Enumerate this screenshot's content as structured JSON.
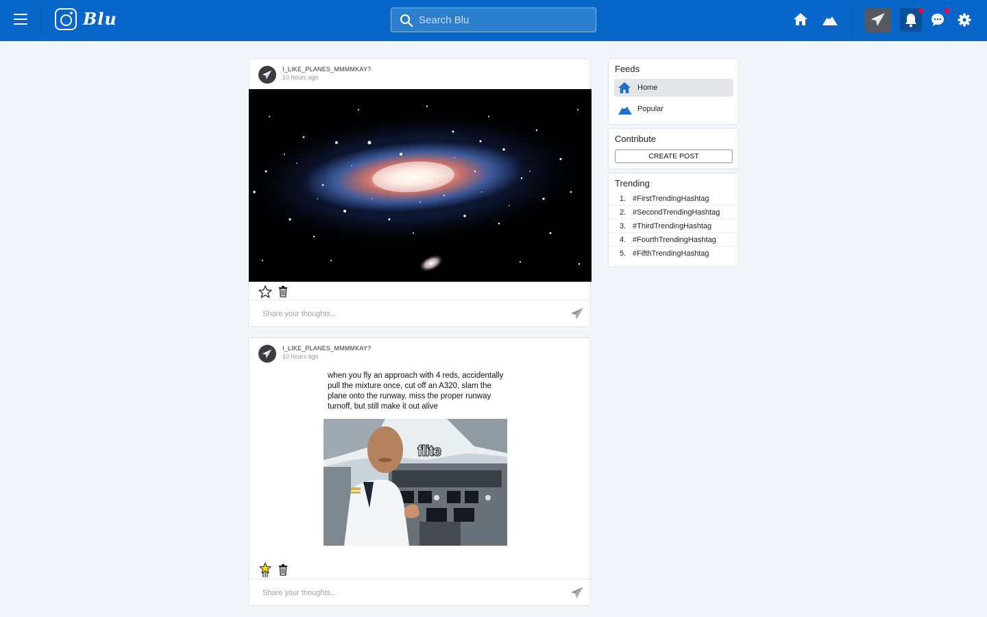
{
  "app": {
    "name": "Blu"
  },
  "search": {
    "placeholder": "Search Blu"
  },
  "colors": {
    "brand": "#0766c7",
    "notification_dot": "#ff0033",
    "star_filled": "#f5d700"
  },
  "header_icons": [
    "menu-icon",
    "home-icon",
    "popular-icon",
    "plane-icon",
    "bell-icon",
    "chat-icon",
    "gear-icon"
  ],
  "posts": [
    {
      "username": "I_LIKE_PLANES_MMMMKAY?",
      "time": "10 hours ago",
      "image": "galaxy",
      "starred": false,
      "comment_placeholder": "Share your thoughts..."
    },
    {
      "username": "I_LIKE_PLANES_MMMMKAY?",
      "time": "10 hours ago",
      "caption": "when you fly an approach with 4 reds, accidentally pull the mixture once, cut off an A320, slam the plane onto the runway, miss the proper runway turnoff, but still make it out alive",
      "image_text": "flite",
      "starred": true,
      "comment_placeholder": "Share your thoughts..."
    }
  ],
  "sidebar": {
    "feeds_title": "Feeds",
    "feeds": [
      {
        "label": "Home",
        "icon": "home-icon",
        "active": true
      },
      {
        "label": "Popular",
        "icon": "popular-icon",
        "active": false
      }
    ],
    "contribute_title": "Contribute",
    "create_post_label": "CREATE POST",
    "trending_title": "Trending",
    "trending": [
      {
        "rank": "1.",
        "tag": "#FirstTrendingHashtag"
      },
      {
        "rank": "2.",
        "tag": "#SecondTrendingHashtag"
      },
      {
        "rank": "3.",
        "tag": "#ThirdTrendingHashtag"
      },
      {
        "rank": "4.",
        "tag": "#FourthTrendingHashtag"
      },
      {
        "rank": "5.",
        "tag": "#FifthTrendingHashtag"
      }
    ]
  }
}
